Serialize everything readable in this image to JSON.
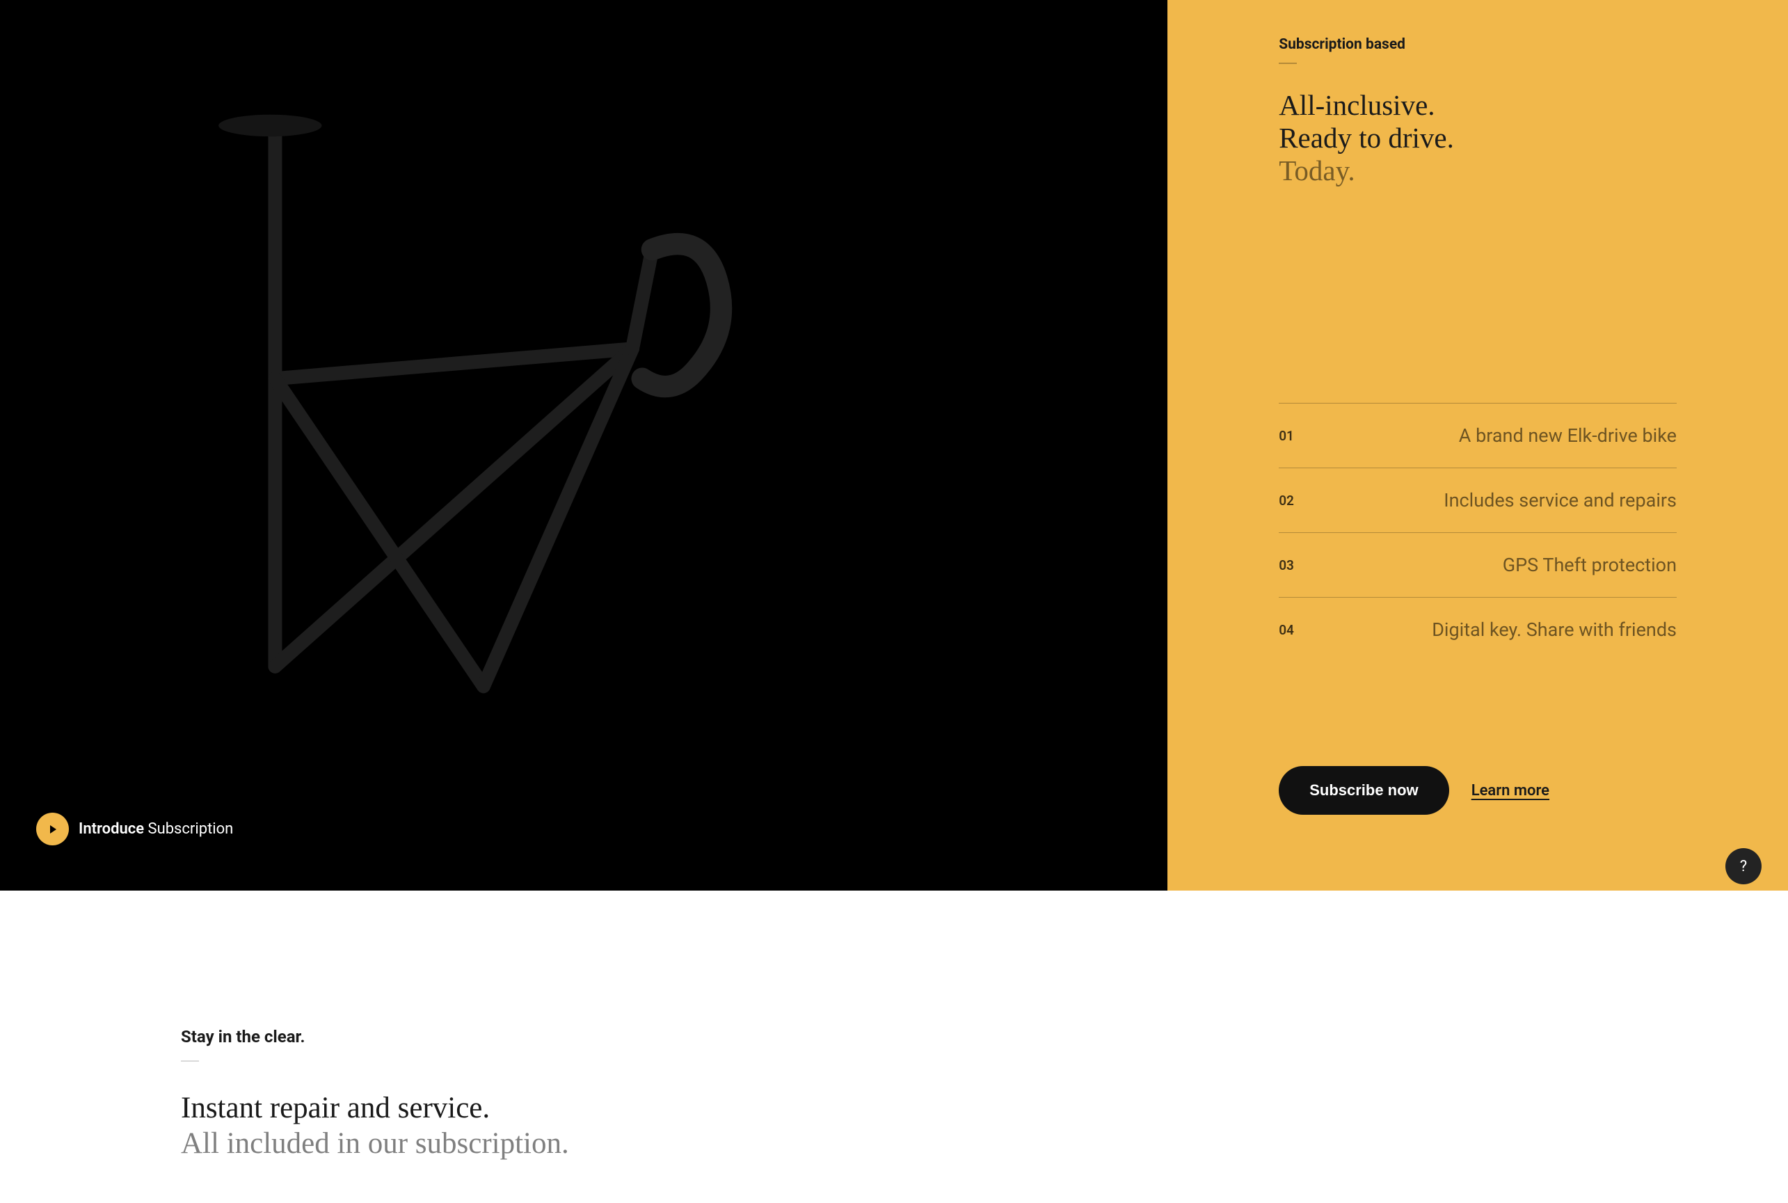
{
  "hero": {
    "intro_strong": "Introduce",
    "intro_rest": " Subscription",
    "right": {
      "eyebrow": "Subscription based",
      "headline_line1": "All-inclusive.",
      "headline_line2": "Ready to drive.",
      "headline_line3": "Today.",
      "features": [
        {
          "num": "01",
          "text": "A brand new Elk-drive bike"
        },
        {
          "num": "02",
          "text": "Includes service and repairs"
        },
        {
          "num": "03",
          "text": "GPS Theft protection"
        },
        {
          "num": "04",
          "text": "Digital key. Share with friends"
        }
      ],
      "subscribe_label": "Subscribe now",
      "learn_more_label": "Learn more"
    }
  },
  "help_label": "?",
  "section2": {
    "eyebrow": "Stay in the clear.",
    "headline_line1": "Instant repair and service.",
    "headline_line2": "All included in our subscription."
  },
  "colors": {
    "accent": "#f1b84b",
    "dark": "#000000",
    "text": "#1a1a1a"
  }
}
